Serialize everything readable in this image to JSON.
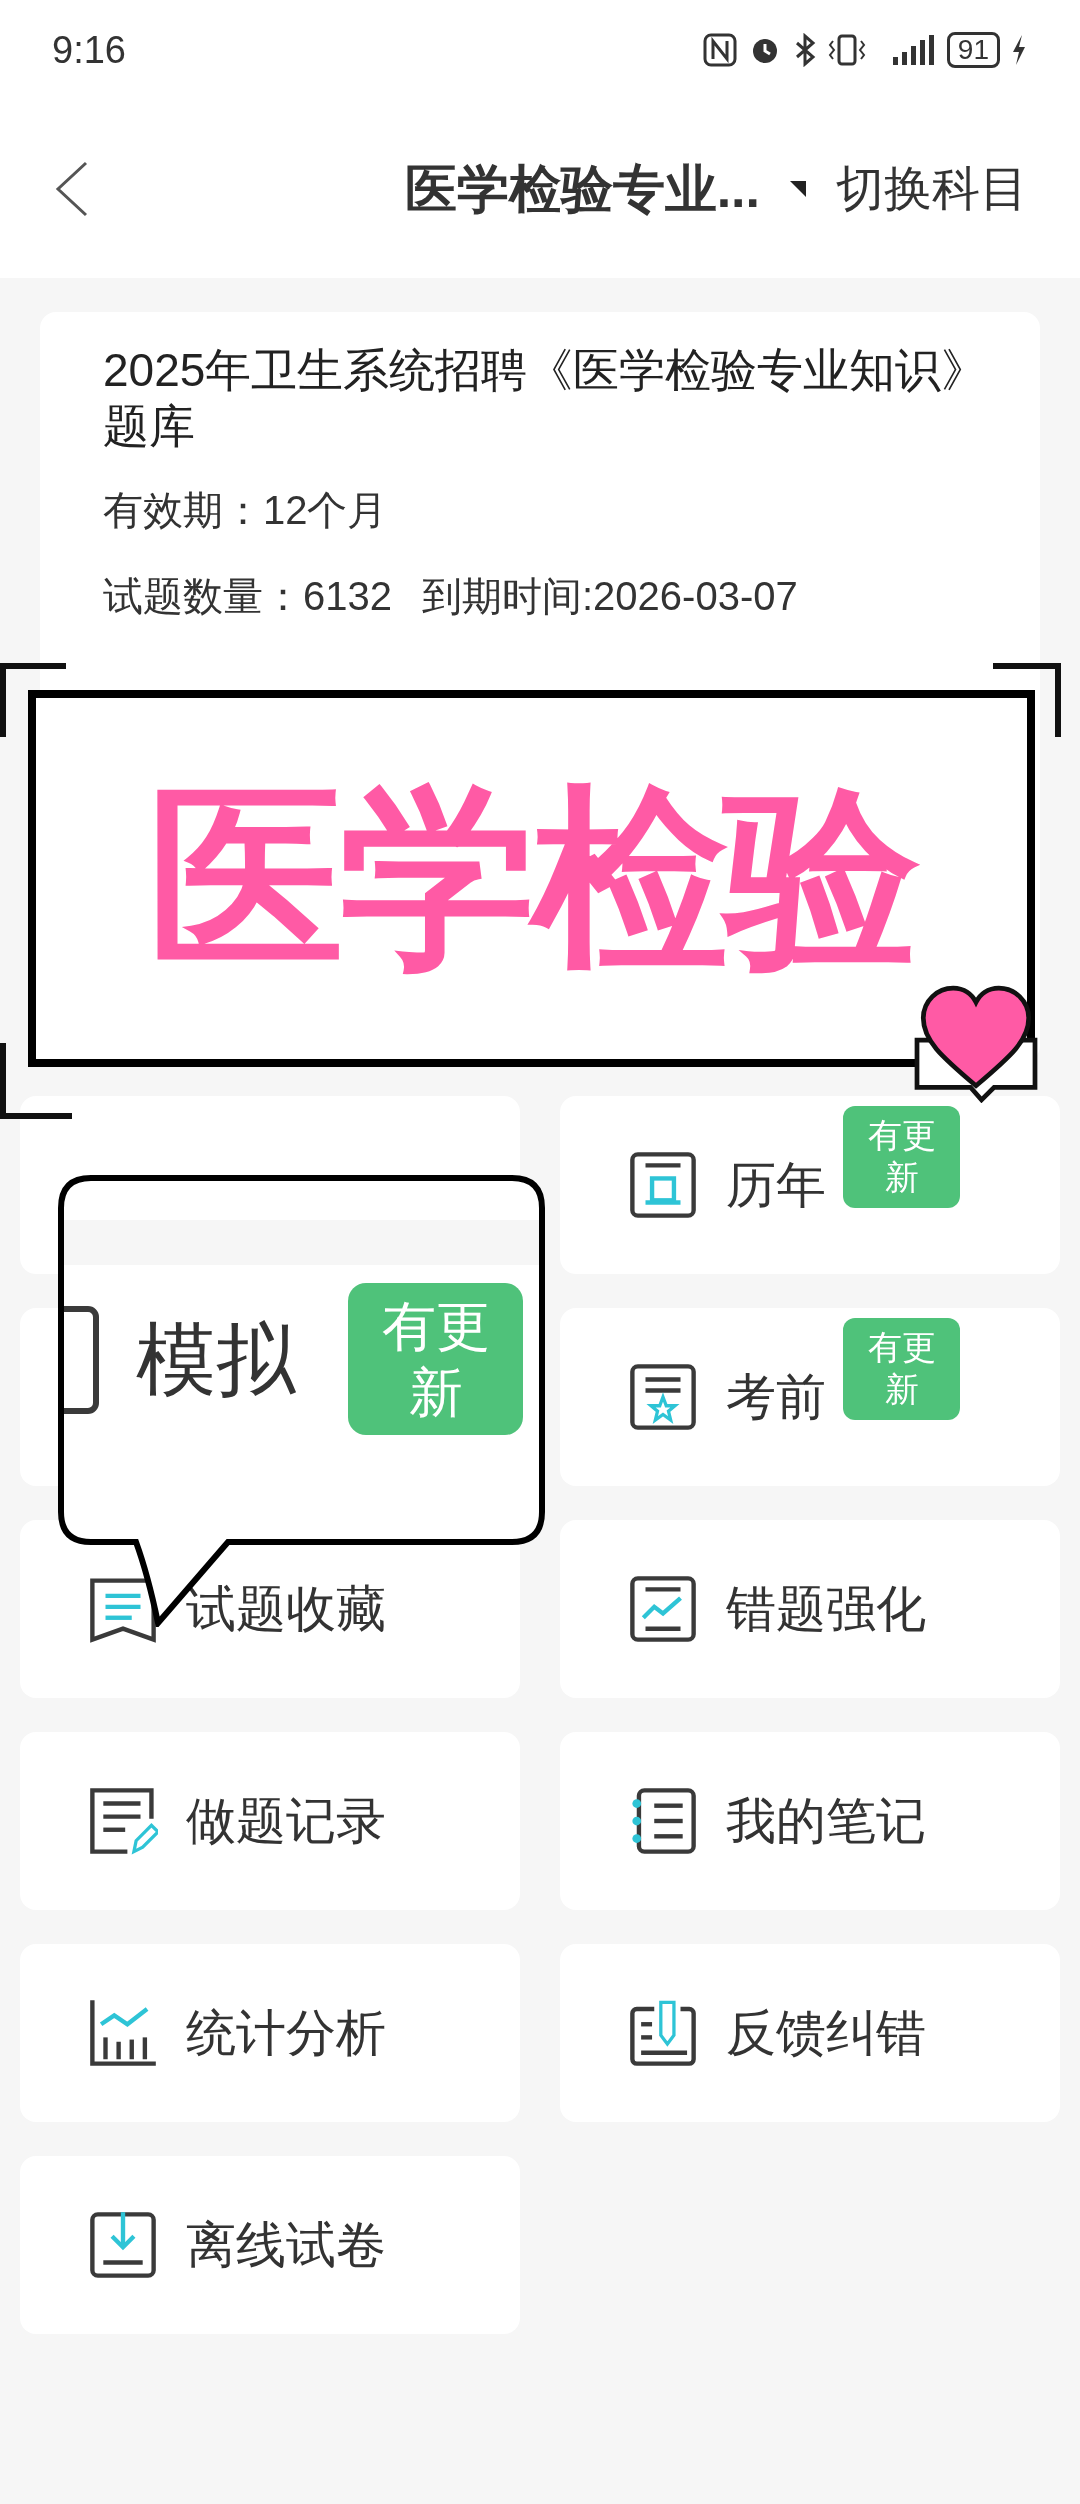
{
  "status_bar": {
    "time": "9:16",
    "battery": "91"
  },
  "header": {
    "title": "医学检验专业...",
    "action": "切换科目"
  },
  "course": {
    "title": "2025年卫生系统招聘《医学检验专业知识》题库",
    "validity": "有效期：12个月",
    "count": "试题数量：6132",
    "expiry": "到期时间:2026-03-07"
  },
  "menu": [
    {
      "kind": "covered"
    },
    {
      "kind": "zhen",
      "label": "历年",
      "badge": "有更新"
    },
    {
      "kind": "covered"
    },
    {
      "kind": "star",
      "label": "考前",
      "badge": "有更新"
    },
    {
      "kind": "bookmark",
      "label": "试题收藏"
    },
    {
      "kind": "trend",
      "label": "错题强化"
    },
    {
      "kind": "edit",
      "label": "做题记录"
    },
    {
      "kind": "notebook",
      "label": "我的笔记"
    },
    {
      "kind": "chart",
      "label": "统计分析"
    },
    {
      "kind": "feedback",
      "label": "反馈纠错"
    },
    {
      "kind": "download",
      "label": "离线试卷"
    }
  ],
  "overlay": {
    "banner": "医学检验",
    "bubble": {
      "label": "模拟",
      "badge": "有更新"
    }
  }
}
